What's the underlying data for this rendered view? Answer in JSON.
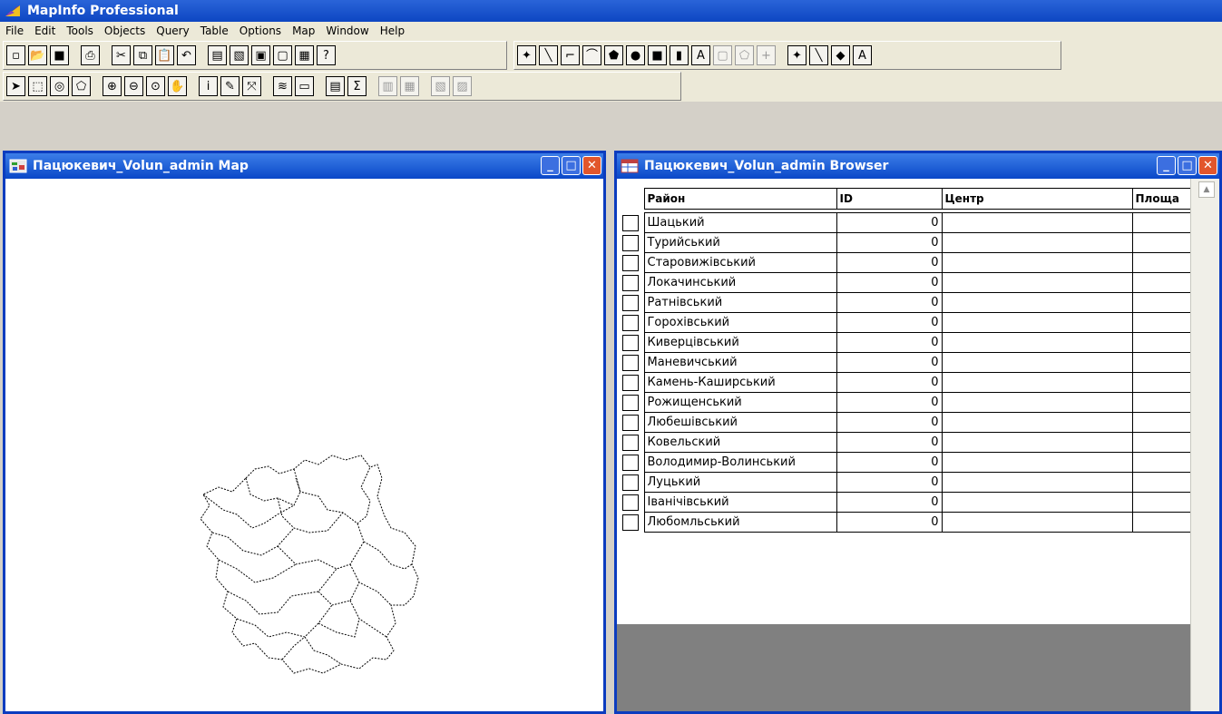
{
  "app": {
    "title": "MapInfo Professional"
  },
  "menu": [
    "File",
    "Edit",
    "Tools",
    "Objects",
    "Query",
    "Table",
    "Options",
    "Map",
    "Window",
    "Help"
  ],
  "map_window": {
    "title": "Пацюкевич_Volun_admin Map"
  },
  "browser_window": {
    "title": "Пацюкевич_Volun_admin Browser",
    "columns": [
      "Район",
      "ID",
      "Центр",
      "Площа"
    ],
    "rows": [
      {
        "name": "Шацький",
        "id": "0"
      },
      {
        "name": "Турийський",
        "id": "0"
      },
      {
        "name": "Старовижівський",
        "id": "0"
      },
      {
        "name": "Локачинський",
        "id": "0"
      },
      {
        "name": "Ратнівський",
        "id": "0"
      },
      {
        "name": "Горохівський",
        "id": "0"
      },
      {
        "name": "Киверцівський",
        "id": "0"
      },
      {
        "name": "Маневичський",
        "id": "0"
      },
      {
        "name": "Камень-Каширський",
        "id": "0"
      },
      {
        "name": "Рожищенський",
        "id": "0"
      },
      {
        "name": "Любешівський",
        "id": "0"
      },
      {
        "name": "Ковельский",
        "id": "0"
      },
      {
        "name": "Володимир-Волинський",
        "id": "0"
      },
      {
        "name": "Луцький",
        "id": "0"
      },
      {
        "name": "Іванічівський",
        "id": "0"
      },
      {
        "name": "Любомльський",
        "id": "0"
      }
    ]
  },
  "toolbar_icons": {
    "main": [
      "new-icon",
      "open-icon",
      "save-icon",
      "print-icon",
      "cut-icon",
      "copy-icon",
      "paste-icon",
      "undo-icon",
      "new-browser-icon",
      "new-mapper-icon",
      "new-grapher-icon",
      "new-layout-icon",
      "new-redistrict-icon",
      "help-icon"
    ],
    "drawing": [
      "symbol-icon",
      "line-icon",
      "polyline-icon",
      "arc-icon",
      "polygon-icon",
      "ellipse-icon",
      "rectangle-icon",
      "rounded-rectangle-icon",
      "text-icon",
      "frame-icon",
      "reshape-icon",
      "add-node-icon",
      "symbol-style-icon",
      "line-style-icon",
      "region-style-icon",
      "text-style-icon"
    ],
    "tools": [
      "select-icon",
      "marquee-select-icon",
      "radius-select-icon",
      "polygon-select-icon",
      "zoom-in-icon",
      "zoom-out-icon",
      "change-view-icon",
      "grabber-icon",
      "info-icon",
      "label-icon",
      "drag-map-icon",
      "layer-control-icon",
      "ruler-icon",
      "legend-icon",
      "statistics-icon",
      "hotlink-icon",
      "clip-region-icon",
      "show-legend-icon",
      "scale-bar-icon"
    ]
  },
  "colors": {
    "title_bar": "#0d46c2",
    "close_button": "#e2562c",
    "browser_empty_area": "#808080"
  }
}
